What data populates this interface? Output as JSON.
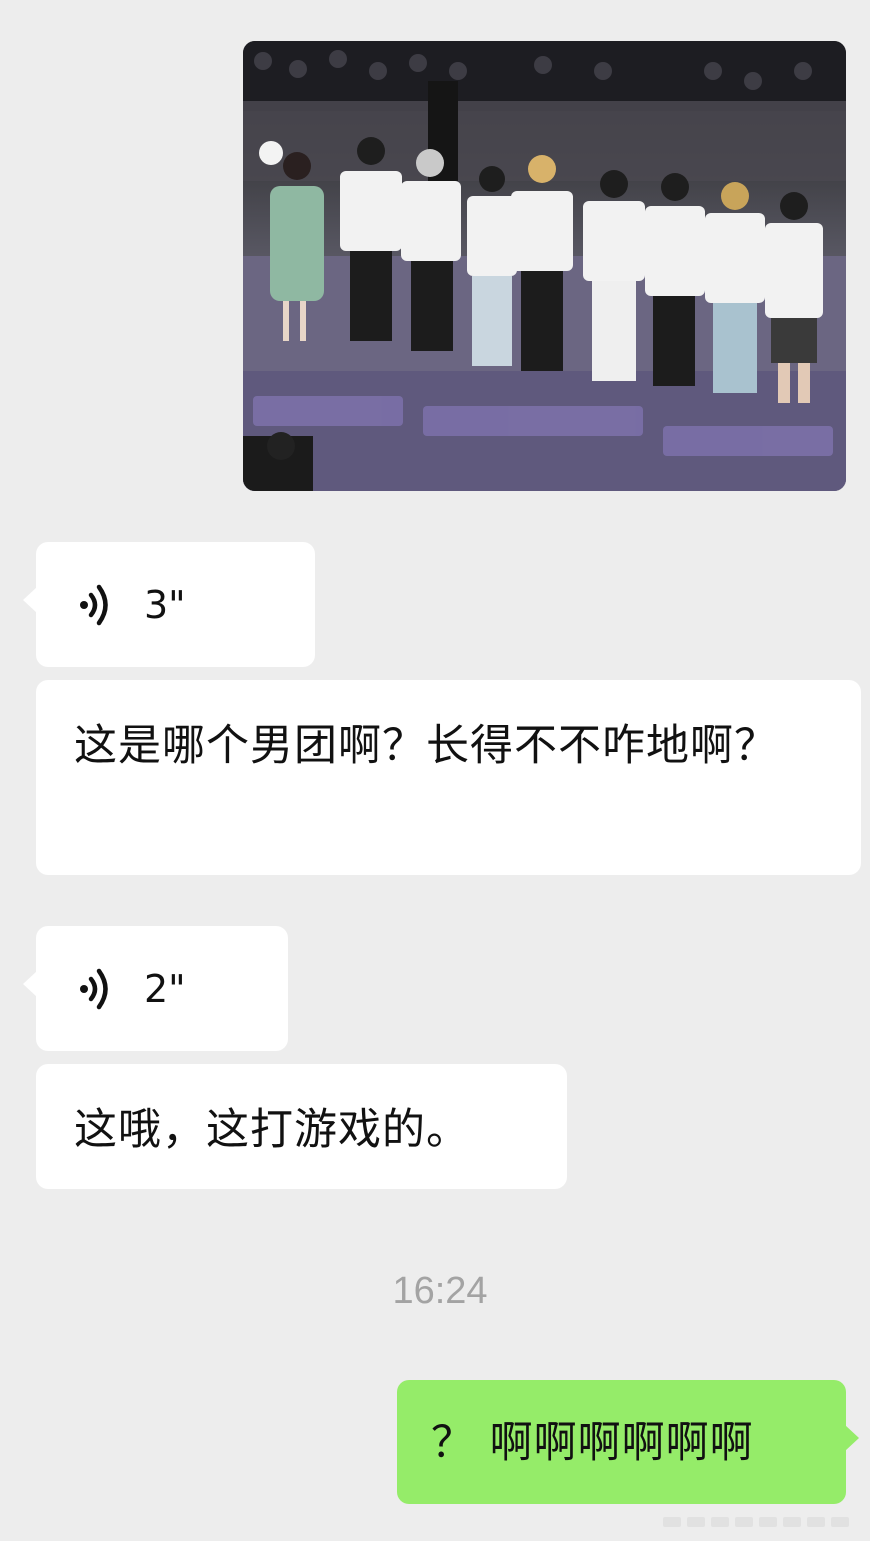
{
  "messages": [
    {
      "type": "image",
      "from": "other"
    },
    {
      "type": "voice",
      "from": "other",
      "duration": "3\""
    },
    {
      "type": "text",
      "from": "other",
      "text": "这是哪个男团啊？长得不不咋地啊？"
    },
    {
      "type": "voice",
      "from": "other",
      "duration": "2\""
    },
    {
      "type": "text",
      "from": "other",
      "text": "这哦，这打游戏的。"
    }
  ],
  "timestamp": "16:24",
  "sent_message": {
    "type": "text",
    "from": "me",
    "text": "？ 啊啊啊啊啊啊"
  },
  "colors": {
    "background": "#ededed",
    "received_bubble": "#ffffff",
    "sent_bubble": "#95ec69",
    "timestamp_text": "#a3a3a3"
  },
  "icons": [
    "voice-wave-icon"
  ]
}
